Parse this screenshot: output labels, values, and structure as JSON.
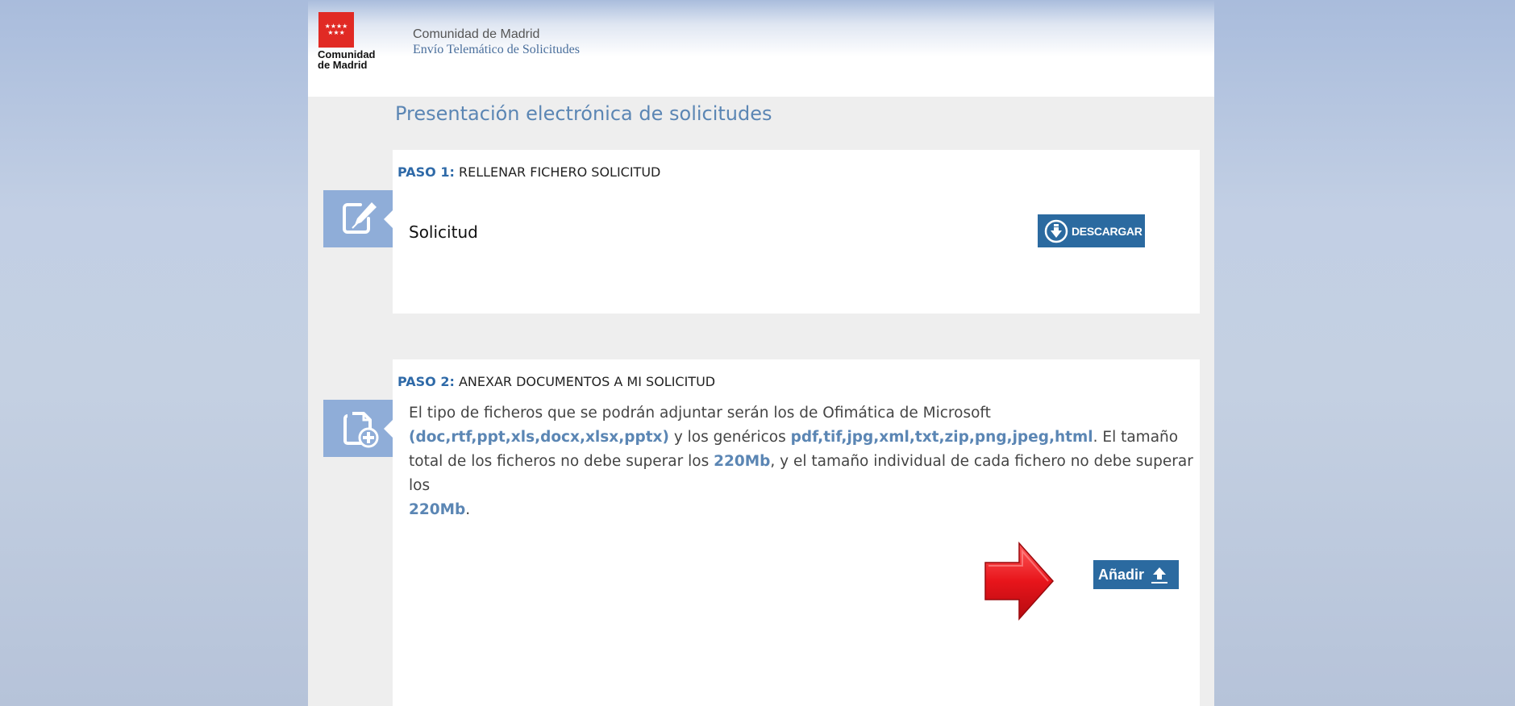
{
  "header": {
    "logo_stars": "★★★★\n★★★",
    "logo_text": "Comunidad\nde Madrid",
    "org": "Comunidad de Madrid",
    "subtitle": "Envío Telemático de Solicitudes"
  },
  "page_title": "Presentación electrónica de solicitudes",
  "step1": {
    "number": "PASO 1:",
    "title": "RELLENAR FICHERO SOLICITUD",
    "icon": "edit-document-icon",
    "item_label": "Solicitud",
    "button_label": "DESCARGAR",
    "button_icon": "download-circle-icon"
  },
  "step2": {
    "number": "PASO 2:",
    "title": "ANEXAR DOCUMENTOS A MI SOLICITUD",
    "icon": "add-document-icon",
    "desc": {
      "t1": "El tipo de ficheros que se podrán adjuntar serán los de Ofimática de Microsoft",
      "ms_formats": "(doc,rtf,ppt,xls,docx,xlsx,pptx)",
      "t2": " y los genéricos ",
      "generic_formats": "pdf,tif,jpg,xml,txt,zip,png,jpeg,html",
      "t3": ". El tamaño total de los ficheros no debe superar los ",
      "total_size": "220Mb",
      "t4": ", y el tamaño individual de cada fichero no debe superar los ",
      "single_size": "220Mb",
      "t5": "."
    },
    "button_label": "Añadir",
    "button_icon": "upload-arrow-icon"
  },
  "colors": {
    "accent": "#5b86b4",
    "button": "#2b6aa0",
    "icon_bg": "#8fadd8",
    "arrow": "#e8151b",
    "logo_red": "#e12a24"
  }
}
